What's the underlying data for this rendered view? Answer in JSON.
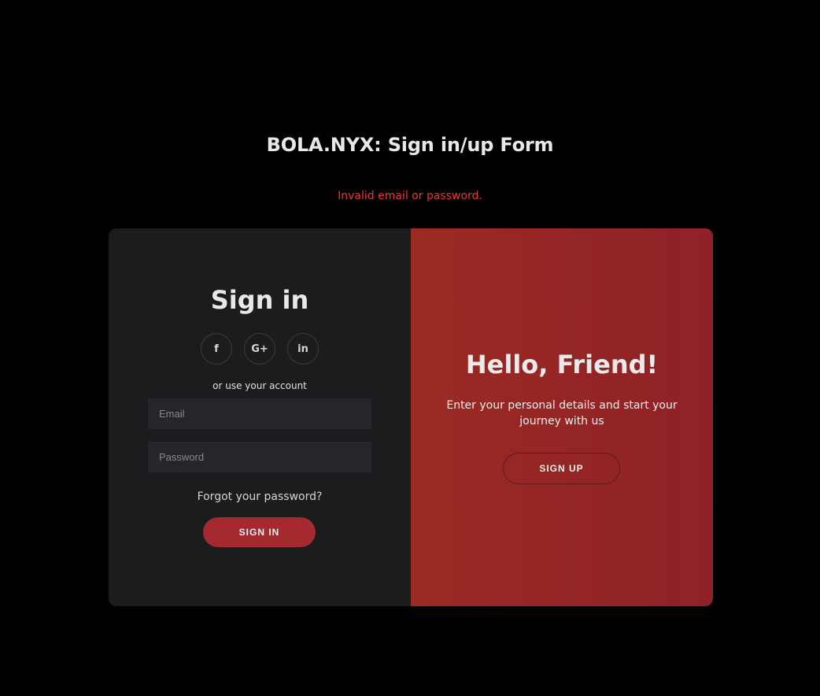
{
  "page": {
    "title": "BOLA.NYX: Sign in/up Form",
    "error": "Invalid email or password."
  },
  "signin": {
    "title": "Sign in",
    "social": [
      {
        "label": "f",
        "icon": "facebook-icon"
      },
      {
        "label": "G+",
        "icon": "google-plus-icon"
      },
      {
        "label": "in",
        "icon": "linkedin-icon"
      }
    ],
    "alt_text": "or use your account",
    "email_placeholder": "Email",
    "password_placeholder": "Password",
    "forgot_label": "Forgot your password?",
    "button_label": "SIGN IN"
  },
  "overlay": {
    "title": "Hello, Friend!",
    "text": "Enter your personal details and start your journey with us",
    "button_label": "SIGN UP"
  },
  "colors": {
    "background": "#000000",
    "error": "#e53935",
    "accent": "#a52a30",
    "panel_dark": "#1b1c1e",
    "panel_red": "#9a2a22"
  }
}
